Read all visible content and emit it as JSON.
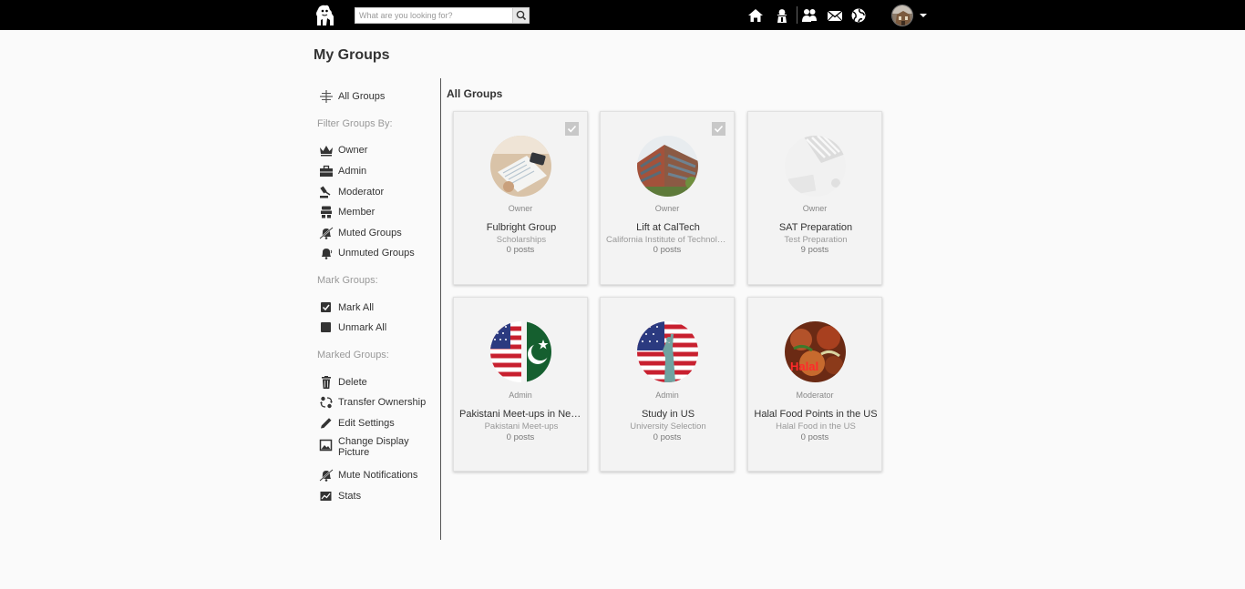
{
  "search": {
    "placeholder": "What are you looking for?"
  },
  "page": {
    "title": "My Groups",
    "section_title": "All Groups"
  },
  "sidebar": {
    "all_groups": "All Groups",
    "filter_heading": "Filter Groups By:",
    "filters": [
      "Owner",
      "Admin",
      "Moderator",
      "Member",
      "Muted Groups",
      "Unmuted Groups"
    ],
    "mark_heading": "Mark Groups:",
    "mark": [
      "Mark All",
      "Unmark All"
    ],
    "marked_heading": "Marked Groups:",
    "marked": [
      "Delete",
      "Transfer Ownership",
      "Edit Settings",
      "Change Display Picture",
      "Mute Notifications",
      "Stats"
    ]
  },
  "groups": [
    {
      "role": "Owner",
      "name": "Fulbright Group",
      "category": "Scholarships",
      "posts": "0 posts",
      "marked": true
    },
    {
      "role": "Owner",
      "name": "Lift at CalTech",
      "category": "California Institute of Technology",
      "posts": "0 posts",
      "marked": true
    },
    {
      "role": "Owner",
      "name": "SAT Preparation",
      "category": "Test Preparation",
      "posts": "9 posts",
      "marked": false
    },
    {
      "role": "Admin",
      "name": "Pakistani Meet-ups in New York",
      "category": "Pakistani Meet-ups",
      "posts": "0 posts",
      "marked": false
    },
    {
      "role": "Admin",
      "name": "Study in US",
      "category": "University Selection",
      "posts": "0 posts",
      "marked": false
    },
    {
      "role": "Moderator",
      "name": "Halal Food Points in the US",
      "category": "Halal Food in the US",
      "posts": "0 posts",
      "marked": false
    }
  ],
  "picture_texts": {
    "halal_food": "Halal"
  },
  "icons": {
    "nav": [
      "home-icon",
      "profile-icon",
      "friends-icon",
      "mail-icon",
      "globe-icon"
    ]
  },
  "colors": {
    "topbar": "#000000",
    "card_bg": "#f3f3f3",
    "check": "#c8c8c8"
  }
}
